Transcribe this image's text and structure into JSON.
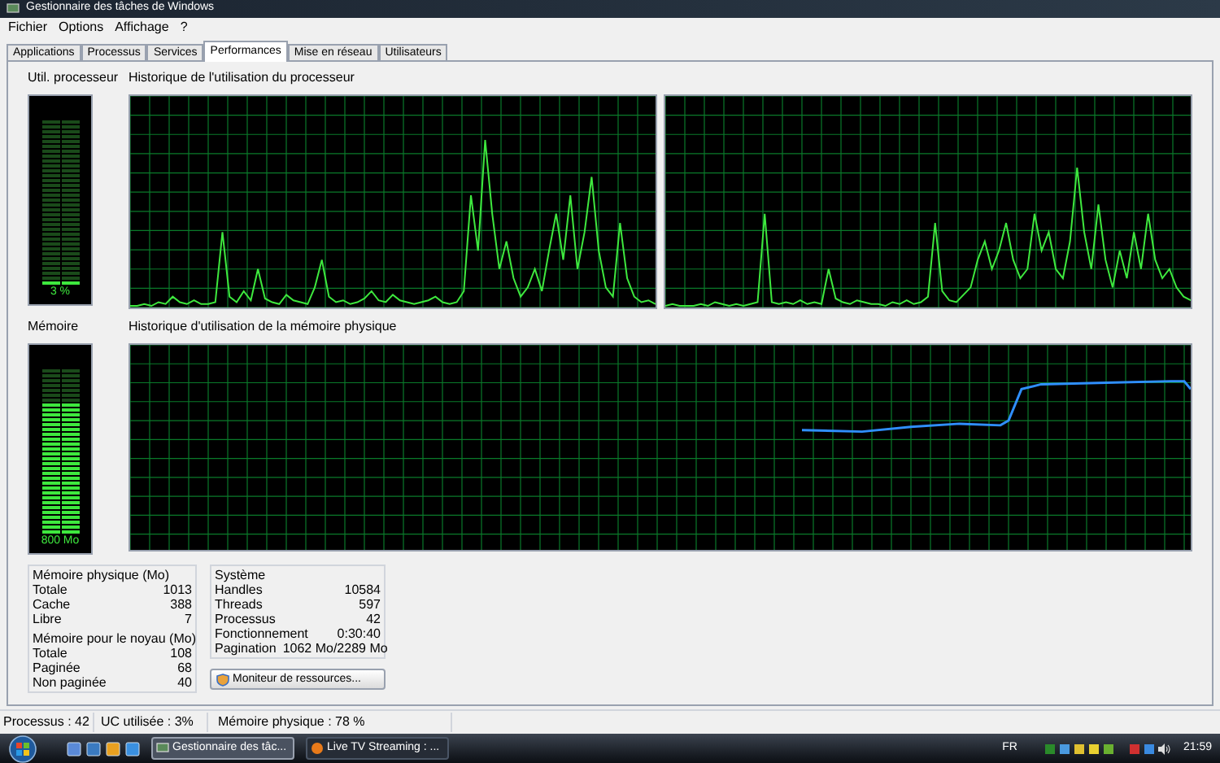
{
  "window": {
    "title": "Gestionnaire des tâches de Windows"
  },
  "menu": [
    "Fichier",
    "Options",
    "Affichage",
    "?"
  ],
  "tabs": [
    {
      "label": "Applications",
      "selected": false
    },
    {
      "label": "Processus",
      "selected": false
    },
    {
      "label": "Services",
      "selected": false
    },
    {
      "label": "Performances",
      "selected": true
    },
    {
      "label": "Mise en réseau",
      "selected": false
    },
    {
      "label": "Utilisateurs",
      "selected": false
    }
  ],
  "cpu_meter": {
    "title": "Util. processeur",
    "level": 0.03,
    "reading": "3 %"
  },
  "cpu_history": {
    "title": "Historique de l'utilisation du processeur"
  },
  "memory_meter": {
    "title": "Mémoire",
    "level": 0.78,
    "reading": "800 Mo"
  },
  "memory_history": {
    "title": "Historique d'utilisation de la mémoire physique"
  },
  "physical_memory": {
    "title": "Mémoire physique (Mo)",
    "rows": [
      [
        "Totale",
        "1013"
      ],
      [
        "Cache",
        "388"
      ],
      [
        "Libre",
        "7"
      ]
    ]
  },
  "kernel_memory": {
    "title": "Mémoire pour le noyau (Mo)",
    "rows": [
      [
        "Totale",
        "108"
      ],
      [
        "Paginée",
        "68"
      ],
      [
        "Non paginée",
        "40"
      ]
    ]
  },
  "system": {
    "title": "Système",
    "rows": [
      [
        "Handles",
        "10584"
      ],
      [
        "Threads",
        "597"
      ],
      [
        "Processus",
        "42"
      ],
      [
        "Fonctionnement",
        "0:30:40"
      ],
      [
        "Pagination",
        "1062 Mo/2289 Mo"
      ]
    ]
  },
  "resource_button": "Moniteur de ressources...",
  "status_bar": [
    "Processus : 42",
    "UC utilisée : 3%",
    "Mémoire physique : 78 %"
  ],
  "taskbar": {
    "buttons": [
      {
        "label": "Gestionnaire des tâc...",
        "selected": true
      },
      {
        "label": "Live TV Streaming : ...",
        "selected": false
      }
    ],
    "language": "FR",
    "clock": "21:59"
  }
}
